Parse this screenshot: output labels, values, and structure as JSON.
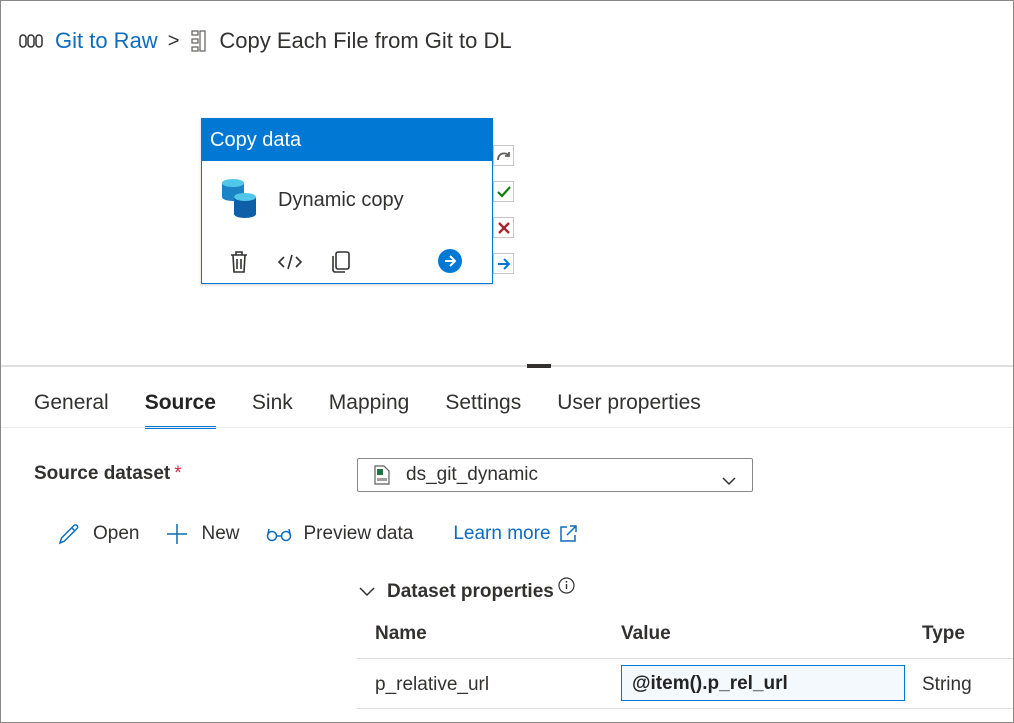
{
  "breadcrumb": {
    "pipeline": "Git to Raw",
    "separator": ">",
    "activity": "Copy Each File from Git to DL"
  },
  "activity": {
    "type_label": "Copy data",
    "name": "Dynamic copy",
    "header_color": "#0078d4"
  },
  "tabs": [
    "General",
    "Source",
    "Sink",
    "Mapping",
    "Settings",
    "User properties"
  ],
  "active_tab": "Source",
  "source": {
    "dataset_label": "Source dataset",
    "required_mark": "*",
    "dataset_value": "ds_git_dynamic",
    "actions": {
      "open": "Open",
      "new": "New",
      "preview": "Preview data",
      "learn_more": "Learn more"
    },
    "dataset_properties": {
      "title": "Dataset properties",
      "columns": {
        "name": "Name",
        "value": "Value",
        "type": "Type"
      },
      "rows": [
        {
          "name": "p_relative_url",
          "value": "@item().p_rel_url",
          "type": "String"
        }
      ]
    }
  }
}
